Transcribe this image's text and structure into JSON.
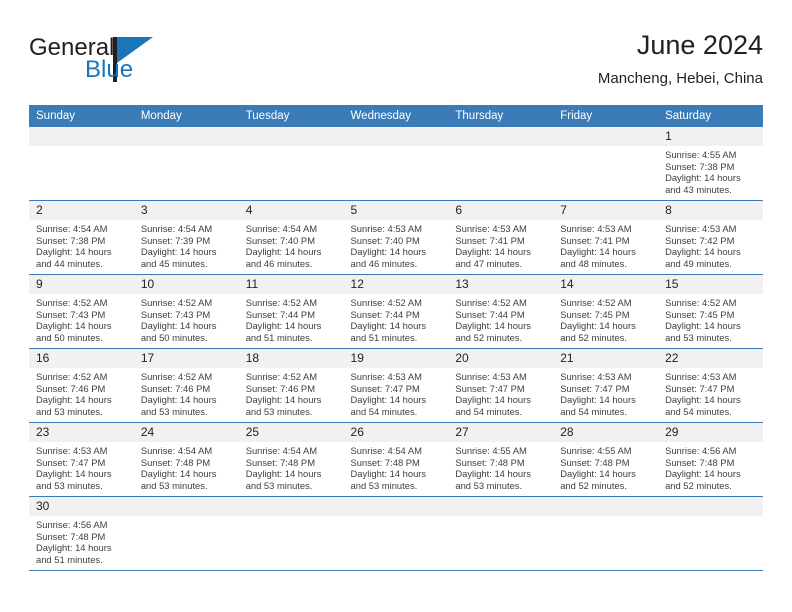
{
  "brand": {
    "name_primary": "General",
    "name_secondary": "Blue",
    "primary_color": "#231f20",
    "secondary_color": "#1b75bb"
  },
  "header": {
    "title": "June 2024",
    "subtitle": "Mancheng, Hebei, China",
    "accent_color": "#3b7cb8"
  },
  "calendar": {
    "weekday_headers": [
      "Sunday",
      "Monday",
      "Tuesday",
      "Wednesday",
      "Thursday",
      "Friday",
      "Saturday"
    ],
    "weeks": [
      [
        {
          "day": "",
          "lines": []
        },
        {
          "day": "",
          "lines": []
        },
        {
          "day": "",
          "lines": []
        },
        {
          "day": "",
          "lines": []
        },
        {
          "day": "",
          "lines": []
        },
        {
          "day": "",
          "lines": []
        },
        {
          "day": "1",
          "sunrise": "Sunrise: 4:55 AM",
          "sunset": "Sunset: 7:38 PM",
          "daylight": "Daylight: 14 hours and 43 minutes."
        }
      ],
      [
        {
          "day": "2",
          "sunrise": "Sunrise: 4:54 AM",
          "sunset": "Sunset: 7:38 PM",
          "daylight": "Daylight: 14 hours and 44 minutes."
        },
        {
          "day": "3",
          "sunrise": "Sunrise: 4:54 AM",
          "sunset": "Sunset: 7:39 PM",
          "daylight": "Daylight: 14 hours and 45 minutes."
        },
        {
          "day": "4",
          "sunrise": "Sunrise: 4:54 AM",
          "sunset": "Sunset: 7:40 PM",
          "daylight": "Daylight: 14 hours and 46 minutes."
        },
        {
          "day": "5",
          "sunrise": "Sunrise: 4:53 AM",
          "sunset": "Sunset: 7:40 PM",
          "daylight": "Daylight: 14 hours and 46 minutes."
        },
        {
          "day": "6",
          "sunrise": "Sunrise: 4:53 AM",
          "sunset": "Sunset: 7:41 PM",
          "daylight": "Daylight: 14 hours and 47 minutes."
        },
        {
          "day": "7",
          "sunrise": "Sunrise: 4:53 AM",
          "sunset": "Sunset: 7:41 PM",
          "daylight": "Daylight: 14 hours and 48 minutes."
        },
        {
          "day": "8",
          "sunrise": "Sunrise: 4:53 AM",
          "sunset": "Sunset: 7:42 PM",
          "daylight": "Daylight: 14 hours and 49 minutes."
        }
      ],
      [
        {
          "day": "9",
          "sunrise": "Sunrise: 4:52 AM",
          "sunset": "Sunset: 7:43 PM",
          "daylight": "Daylight: 14 hours and 50 minutes."
        },
        {
          "day": "10",
          "sunrise": "Sunrise: 4:52 AM",
          "sunset": "Sunset: 7:43 PM",
          "daylight": "Daylight: 14 hours and 50 minutes."
        },
        {
          "day": "11",
          "sunrise": "Sunrise: 4:52 AM",
          "sunset": "Sunset: 7:44 PM",
          "daylight": "Daylight: 14 hours and 51 minutes."
        },
        {
          "day": "12",
          "sunrise": "Sunrise: 4:52 AM",
          "sunset": "Sunset: 7:44 PM",
          "daylight": "Daylight: 14 hours and 51 minutes."
        },
        {
          "day": "13",
          "sunrise": "Sunrise: 4:52 AM",
          "sunset": "Sunset: 7:44 PM",
          "daylight": "Daylight: 14 hours and 52 minutes."
        },
        {
          "day": "14",
          "sunrise": "Sunrise: 4:52 AM",
          "sunset": "Sunset: 7:45 PM",
          "daylight": "Daylight: 14 hours and 52 minutes."
        },
        {
          "day": "15",
          "sunrise": "Sunrise: 4:52 AM",
          "sunset": "Sunset: 7:45 PM",
          "daylight": "Daylight: 14 hours and 53 minutes."
        }
      ],
      [
        {
          "day": "16",
          "sunrise": "Sunrise: 4:52 AM",
          "sunset": "Sunset: 7:46 PM",
          "daylight": "Daylight: 14 hours and 53 minutes."
        },
        {
          "day": "17",
          "sunrise": "Sunrise: 4:52 AM",
          "sunset": "Sunset: 7:46 PM",
          "daylight": "Daylight: 14 hours and 53 minutes."
        },
        {
          "day": "18",
          "sunrise": "Sunrise: 4:52 AM",
          "sunset": "Sunset: 7:46 PM",
          "daylight": "Daylight: 14 hours and 53 minutes."
        },
        {
          "day": "19",
          "sunrise": "Sunrise: 4:53 AM",
          "sunset": "Sunset: 7:47 PM",
          "daylight": "Daylight: 14 hours and 54 minutes."
        },
        {
          "day": "20",
          "sunrise": "Sunrise: 4:53 AM",
          "sunset": "Sunset: 7:47 PM",
          "daylight": "Daylight: 14 hours and 54 minutes."
        },
        {
          "day": "21",
          "sunrise": "Sunrise: 4:53 AM",
          "sunset": "Sunset: 7:47 PM",
          "daylight": "Daylight: 14 hours and 54 minutes."
        },
        {
          "day": "22",
          "sunrise": "Sunrise: 4:53 AM",
          "sunset": "Sunset: 7:47 PM",
          "daylight": "Daylight: 14 hours and 54 minutes."
        }
      ],
      [
        {
          "day": "23",
          "sunrise": "Sunrise: 4:53 AM",
          "sunset": "Sunset: 7:47 PM",
          "daylight": "Daylight: 14 hours and 53 minutes."
        },
        {
          "day": "24",
          "sunrise": "Sunrise: 4:54 AM",
          "sunset": "Sunset: 7:48 PM",
          "daylight": "Daylight: 14 hours and 53 minutes."
        },
        {
          "day": "25",
          "sunrise": "Sunrise: 4:54 AM",
          "sunset": "Sunset: 7:48 PM",
          "daylight": "Daylight: 14 hours and 53 minutes."
        },
        {
          "day": "26",
          "sunrise": "Sunrise: 4:54 AM",
          "sunset": "Sunset: 7:48 PM",
          "daylight": "Daylight: 14 hours and 53 minutes."
        },
        {
          "day": "27",
          "sunrise": "Sunrise: 4:55 AM",
          "sunset": "Sunset: 7:48 PM",
          "daylight": "Daylight: 14 hours and 53 minutes."
        },
        {
          "day": "28",
          "sunrise": "Sunrise: 4:55 AM",
          "sunset": "Sunset: 7:48 PM",
          "daylight": "Daylight: 14 hours and 52 minutes."
        },
        {
          "day": "29",
          "sunrise": "Sunrise: 4:56 AM",
          "sunset": "Sunset: 7:48 PM",
          "daylight": "Daylight: 14 hours and 52 minutes."
        }
      ],
      [
        {
          "day": "30",
          "sunrise": "Sunrise: 4:56 AM",
          "sunset": "Sunset: 7:48 PM",
          "daylight": "Daylight: 14 hours and 51 minutes."
        },
        {
          "day": "",
          "lines": []
        },
        {
          "day": "",
          "lines": []
        },
        {
          "day": "",
          "lines": []
        },
        {
          "day": "",
          "lines": []
        },
        {
          "day": "",
          "lines": []
        },
        {
          "day": "",
          "lines": []
        }
      ]
    ]
  }
}
